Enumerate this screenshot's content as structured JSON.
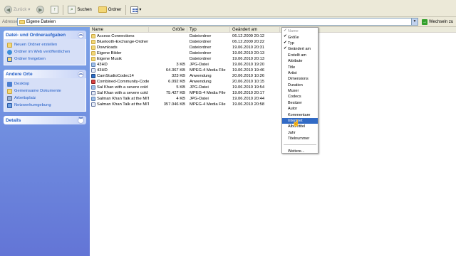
{
  "toolbar": {
    "back_label": "Zurück",
    "search_label": "Suchen",
    "folders_label": "Ordner"
  },
  "address": {
    "label": "Adresse",
    "value": "Eigene Dateien",
    "go_label": "Wechseln zu"
  },
  "taskpane": {
    "file_tasks": {
      "title": "Datei- und Ordneraufgaben",
      "items": [
        "Neuen Ordner erstellen",
        "Ordner im Web veröffentlichen",
        "Ordner freigeben"
      ]
    },
    "other_places": {
      "title": "Andere Orte",
      "items": [
        "Desktop",
        "Gemeinsame Dokumente",
        "Arbeitsplatz",
        "Netzwerkumgebung"
      ]
    },
    "details": {
      "title": "Details"
    }
  },
  "columns": {
    "name": "Name",
    "size": "Größe",
    "type": "Typ",
    "date": "Geändert am"
  },
  "files": [
    {
      "name": "Access Connections",
      "size": "",
      "type": "Dateiordner",
      "date": "06.12.2009 20:12",
      "icon": "folder-icon"
    },
    {
      "name": "Bluetooth-Exchange-Ordner",
      "size": "",
      "type": "Dateiordner",
      "date": "06.12.2009 20:22",
      "icon": "folder-icon"
    },
    {
      "name": "Downloads",
      "size": "",
      "type": "Dateiordner",
      "date": "19.06.2010 20:31",
      "icon": "folder-icon"
    },
    {
      "name": "Eigene Bilder",
      "size": "",
      "type": "Dateiordner",
      "date": "19.06.2010 20:13",
      "icon": "folder-icon"
    },
    {
      "name": "Eigene Musik",
      "size": "",
      "type": "Dateiordner",
      "date": "19.06.2010 20:13",
      "icon": "folder-icon"
    },
    {
      "name": "43HD",
      "size": "3 KB",
      "type": "JPG-Datei",
      "date": "19.06.2010 19:20",
      "icon": "jpg-file-icon"
    },
    {
      "name": "43HD",
      "size": "64.367 KB",
      "type": "MPEG-4 Media File",
      "date": "19.06.2010 19:46",
      "icon": "mp4-file-icon"
    },
    {
      "name": "CamStudioCodec14",
      "size": "323 KB",
      "type": "Anwendung",
      "date": "20.06.2010 10:26",
      "icon": "application-icon"
    },
    {
      "name": "Combined-Community-Codec-...",
      "size": "6.092 KB",
      "type": "Anwendung",
      "date": "20.06.2010 10:15",
      "icon": "application-icon"
    },
    {
      "name": "Sal Khan with a severe cold o...",
      "size": "5 KB",
      "type": "JPG-Datei",
      "date": "19.06.2010 19:54",
      "icon": "jpg-file-icon"
    },
    {
      "name": "Sal Khan with a severe cold o...",
      "size": "75.427 KB",
      "type": "MPEG-4 Media File",
      "date": "19.06.2010 20:17",
      "icon": "mp4-file-icon"
    },
    {
      "name": "Salman Khan Talk at the MIT ...",
      "size": "4 KB",
      "type": "JPG-Datei",
      "date": "19.06.2010 20:44",
      "icon": "jpg-file-icon"
    },
    {
      "name": "Salman Khan Talk at the MIT ...",
      "size": "357.046 KB",
      "type": "MPEG-4 Media File",
      "date": "19.06.2010 20:58",
      "icon": "mp4-file-icon"
    }
  ],
  "context_menu": {
    "items": [
      {
        "label": "Name",
        "checked": true,
        "disabled": true
      },
      {
        "label": "Größe",
        "checked": true
      },
      {
        "label": "Typ",
        "checked": true
      },
      {
        "label": "Geändert am",
        "checked": true
      },
      {
        "label": "Erstellt am"
      },
      {
        "label": "Attribute"
      },
      {
        "label": "Title"
      },
      {
        "label": "Artist"
      },
      {
        "label": "Dimensions"
      },
      {
        "label": "Duration"
      },
      {
        "label": "Muxer"
      },
      {
        "label": "Codecs"
      },
      {
        "label": "Besitzer"
      },
      {
        "label": "Autor"
      },
      {
        "label": "Kommentare"
      },
      {
        "label": "Interpret",
        "highlighted": true
      },
      {
        "label": "Albumtitel"
      },
      {
        "label": "Jahr"
      },
      {
        "label": "Titelnummer"
      }
    ],
    "more_label": "Weitere..."
  },
  "colors": {
    "selection": "#316ac5",
    "taskpane_top": "#7ba2e7",
    "taskpane_bottom": "#6375d6",
    "link": "#215dc6"
  }
}
